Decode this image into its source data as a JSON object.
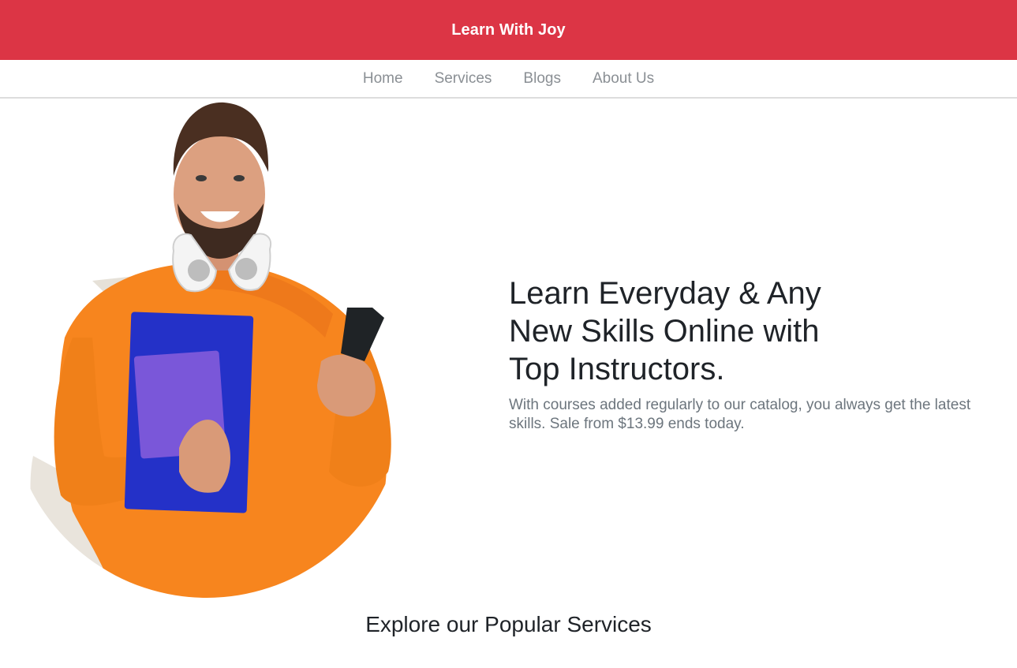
{
  "header": {
    "brand": "Learn With Joy",
    "brand_color": "#dc3545"
  },
  "nav": {
    "items": [
      {
        "label": "Home"
      },
      {
        "label": "Services"
      },
      {
        "label": "Blogs"
      },
      {
        "label": "About Us"
      }
    ]
  },
  "hero": {
    "image_subject": "smiling student in orange sweater holding notebooks and phone",
    "title": "Learn Everyday & Any New Skills Online with Top Instructors.",
    "subtitle": "With courses added regularly to our catalog, you always get the latest skills. Sale from $13.99 ends today."
  },
  "services": {
    "title": "Explore our Popular Services"
  }
}
